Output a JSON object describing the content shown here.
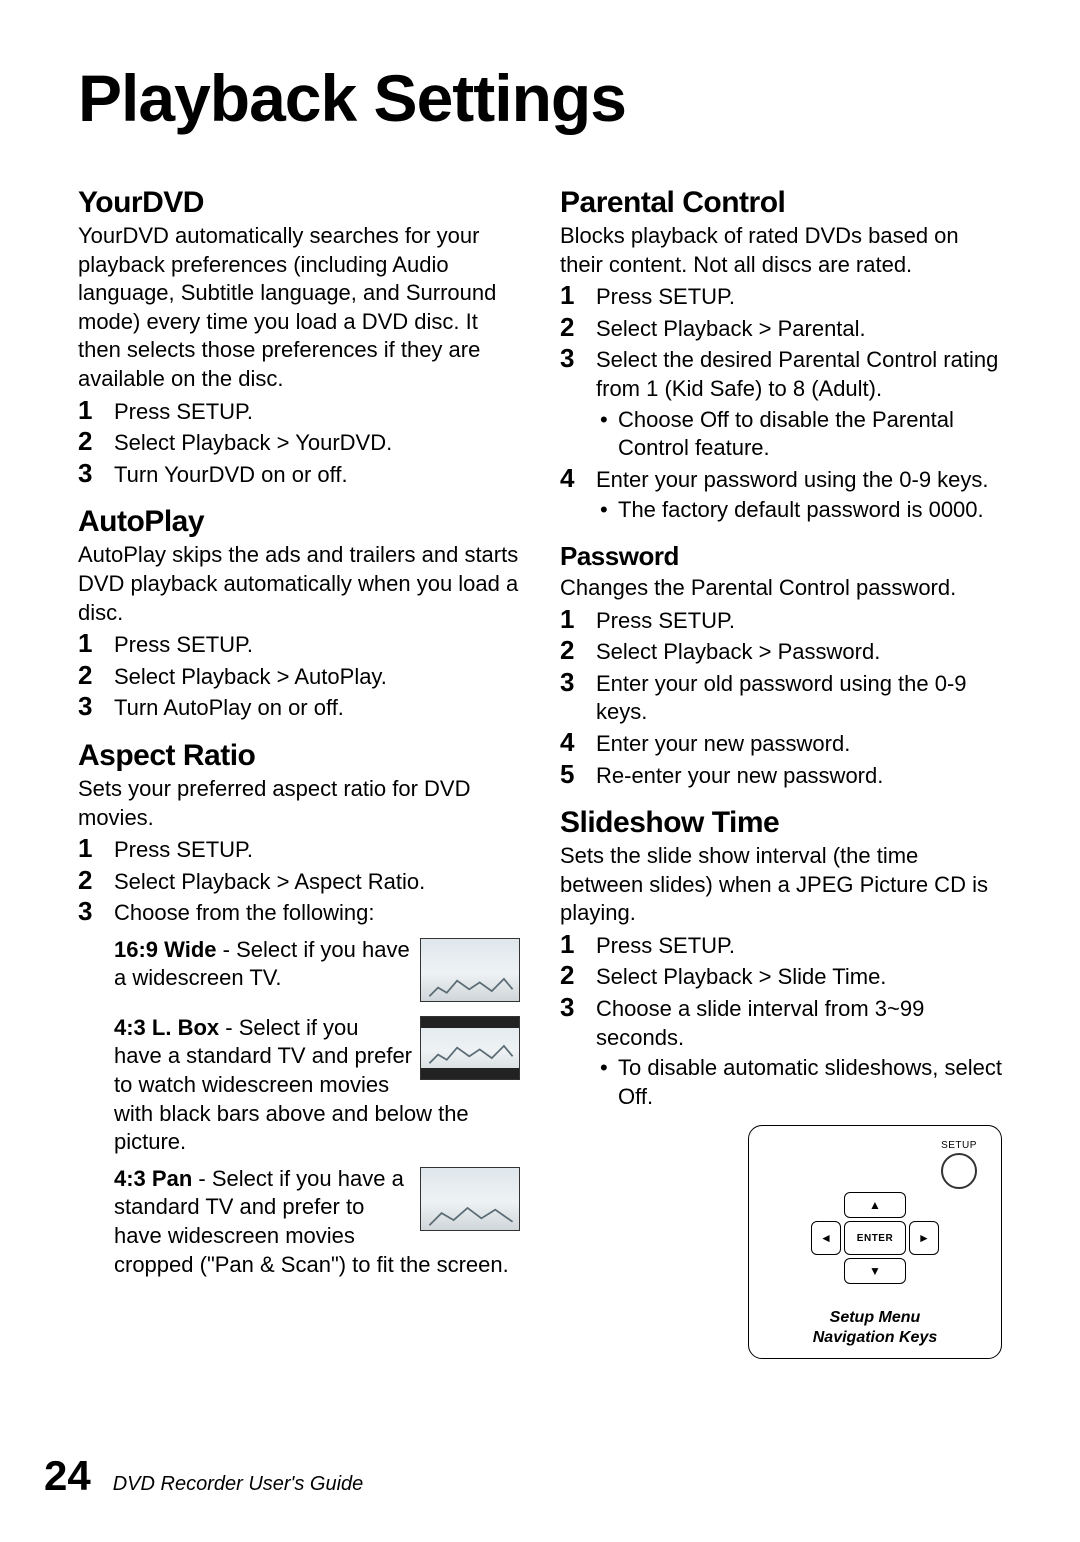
{
  "title": "Playback Settings",
  "page_number": "24",
  "footer_text": "DVD Recorder User's Guide",
  "left": {
    "yourdvd": {
      "heading": "YourDVD",
      "intro": "YourDVD automatically searches for your playback preferences (including Audio language, Subtitle language, and Surround mode) every time you load a DVD disc. It then selects those preferences if they are available on the disc.",
      "steps": [
        "Press SETUP.",
        "Select Playback > YourDVD.",
        "Turn YourDVD on or off."
      ]
    },
    "autoplay": {
      "heading": "AutoPlay",
      "intro": "AutoPlay skips the ads and trailers and starts DVD playback automatically when you load a disc.",
      "steps": [
        "Press SETUP.",
        "Select Playback > AutoPlay.",
        "Turn AutoPlay on or off."
      ]
    },
    "aspect": {
      "heading": "Aspect Ratio",
      "intro": "Sets your preferred aspect ratio for DVD movies.",
      "steps": [
        "Press SETUP.",
        "Select Playback > Aspect Ratio.",
        "Choose from the following:"
      ],
      "options": [
        {
          "label": "16:9 Wide",
          "text": " - Select if you have a widescreen TV."
        },
        {
          "label": "4:3 L. Box",
          "text": " - Select if you have a standard TV and prefer to watch widescreen movies with black bars above and below the picture."
        },
        {
          "label": "4:3 Pan",
          "text": " - Select if you have a standard TV and prefer to have widescreen movies cropped (\"Pan & Scan\") to fit the screen."
        }
      ]
    }
  },
  "right": {
    "parental": {
      "heading": "Parental Control",
      "intro": "Blocks playback of rated DVDs based on their content. Not all discs are rated.",
      "steps": [
        "Press SETUP.",
        "Select Playback > Parental.",
        "Select the desired Parental Control rating from 1 (Kid Safe) to 8 (Adult).",
        "Enter your password using the 0-9 keys."
      ],
      "step3_bullet": "Choose Off to disable the Parental Control feature.",
      "step4_bullet": "The factory default password is 0000."
    },
    "password": {
      "heading": "Password",
      "intro": "Changes the Parental Control password.",
      "steps": [
        "Press SETUP.",
        "Select Playback > Password.",
        "Enter your old password using the 0-9 keys.",
        "Enter your new password.",
        "Re-enter your new password."
      ]
    },
    "slideshow": {
      "heading": "Slideshow Time",
      "intro": "Sets the slide show interval (the time between slides) when a JPEG Picture CD is playing.",
      "steps": [
        "Press SETUP.",
        "Select Playback > Slide Time.",
        "Choose a slide interval from 3~99 seconds."
      ],
      "step3_bullet": "To disable automatic slideshows, select Off."
    }
  },
  "remote": {
    "setup_label": "SETUP",
    "enter_label": "ENTER",
    "caption_line1": "Setup Menu",
    "caption_line2": "Navigation Keys"
  }
}
